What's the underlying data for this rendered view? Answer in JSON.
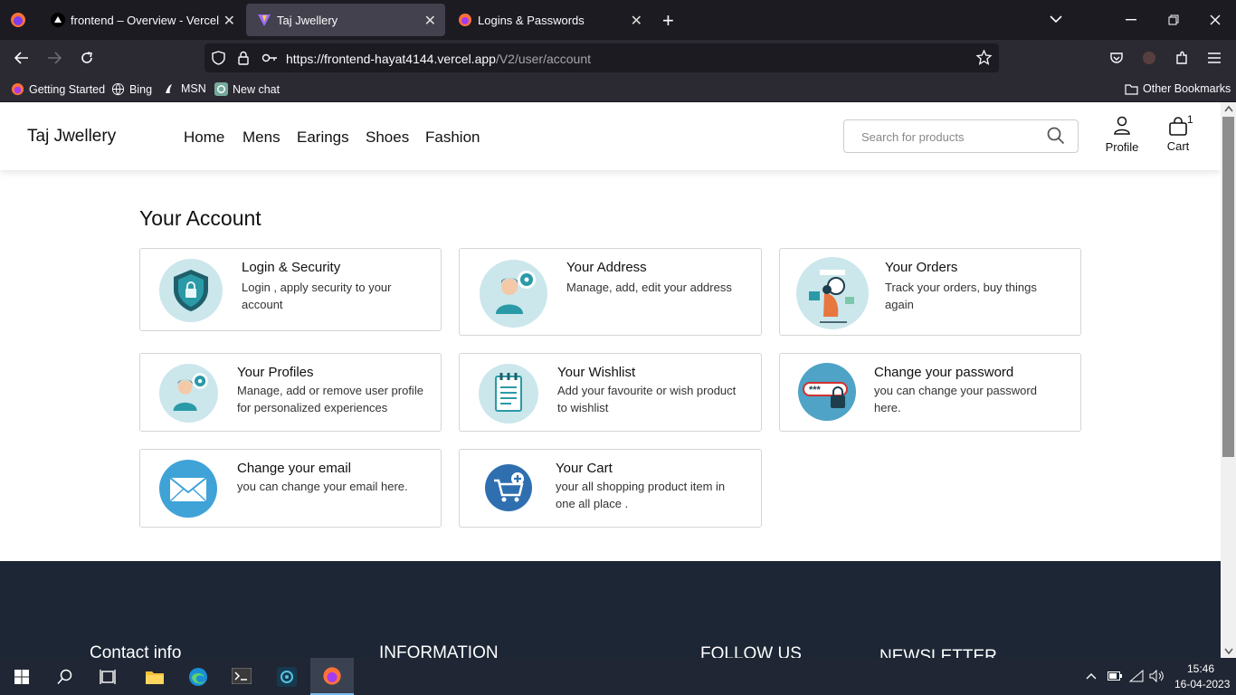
{
  "browser": {
    "tabs": [
      {
        "title": "frontend – Overview - Vercel",
        "close": "✕"
      },
      {
        "title": "Taj Jwellery",
        "close": "✕"
      },
      {
        "title": "Logins & Passwords",
        "close": "✕"
      }
    ],
    "new_tab": "+",
    "url_host": "https://frontend-hayat4144.vercel.app",
    "url_path": "/V2/user/account",
    "bookmarks": [
      "Getting Started",
      "Bing",
      "MSN",
      "New chat"
    ],
    "other_bookmarks": "Other Bookmarks"
  },
  "site": {
    "brand": "Taj Jwellery",
    "nav": [
      "Home",
      "Mens",
      "Earings",
      "Shoes",
      "Fashion"
    ],
    "search_placeholder": "Search for products",
    "profile_label": "Profile",
    "cart_label": "Cart",
    "cart_count": "1"
  },
  "account": {
    "title": "Your Account",
    "cards": [
      {
        "title": "Login & Security",
        "desc": "Login , apply security to your account",
        "icon": "shield-lock-icon"
      },
      {
        "title": "Your Address",
        "desc": "Manage, add, edit your address",
        "icon": "user-gear-icon"
      },
      {
        "title": "Your Orders",
        "desc": "Track your orders, buy things again",
        "icon": "orders-icon"
      },
      {
        "title": "Your Profiles",
        "desc": "Manage, add or remove user profile for personalized experiences",
        "icon": "user-gear-icon"
      },
      {
        "title": "Your Wishlist",
        "desc": "Add your favourite or wish product to wishlist",
        "icon": "notepad-icon"
      },
      {
        "title": "Change your password",
        "desc": "you can change your password here.",
        "icon": "password-lock-icon"
      },
      {
        "title": "Change your email",
        "desc": "you can change your email here.",
        "icon": "envelope-icon"
      },
      {
        "title": "Your Cart",
        "desc": "your all shopping product item in one all place .",
        "icon": "cart-plus-icon"
      }
    ]
  },
  "footer": {
    "headings": [
      "Contact info",
      "INFORMATION",
      "FOLLOW US",
      "NEWSLETTER"
    ]
  },
  "taskbar": {
    "time": "15:46",
    "date": "16-04-2023"
  },
  "colors": {
    "accent_teal": "#2a9aa7",
    "footer_bg": "#1c2634",
    "circle_bg": "#cbe7ec"
  }
}
